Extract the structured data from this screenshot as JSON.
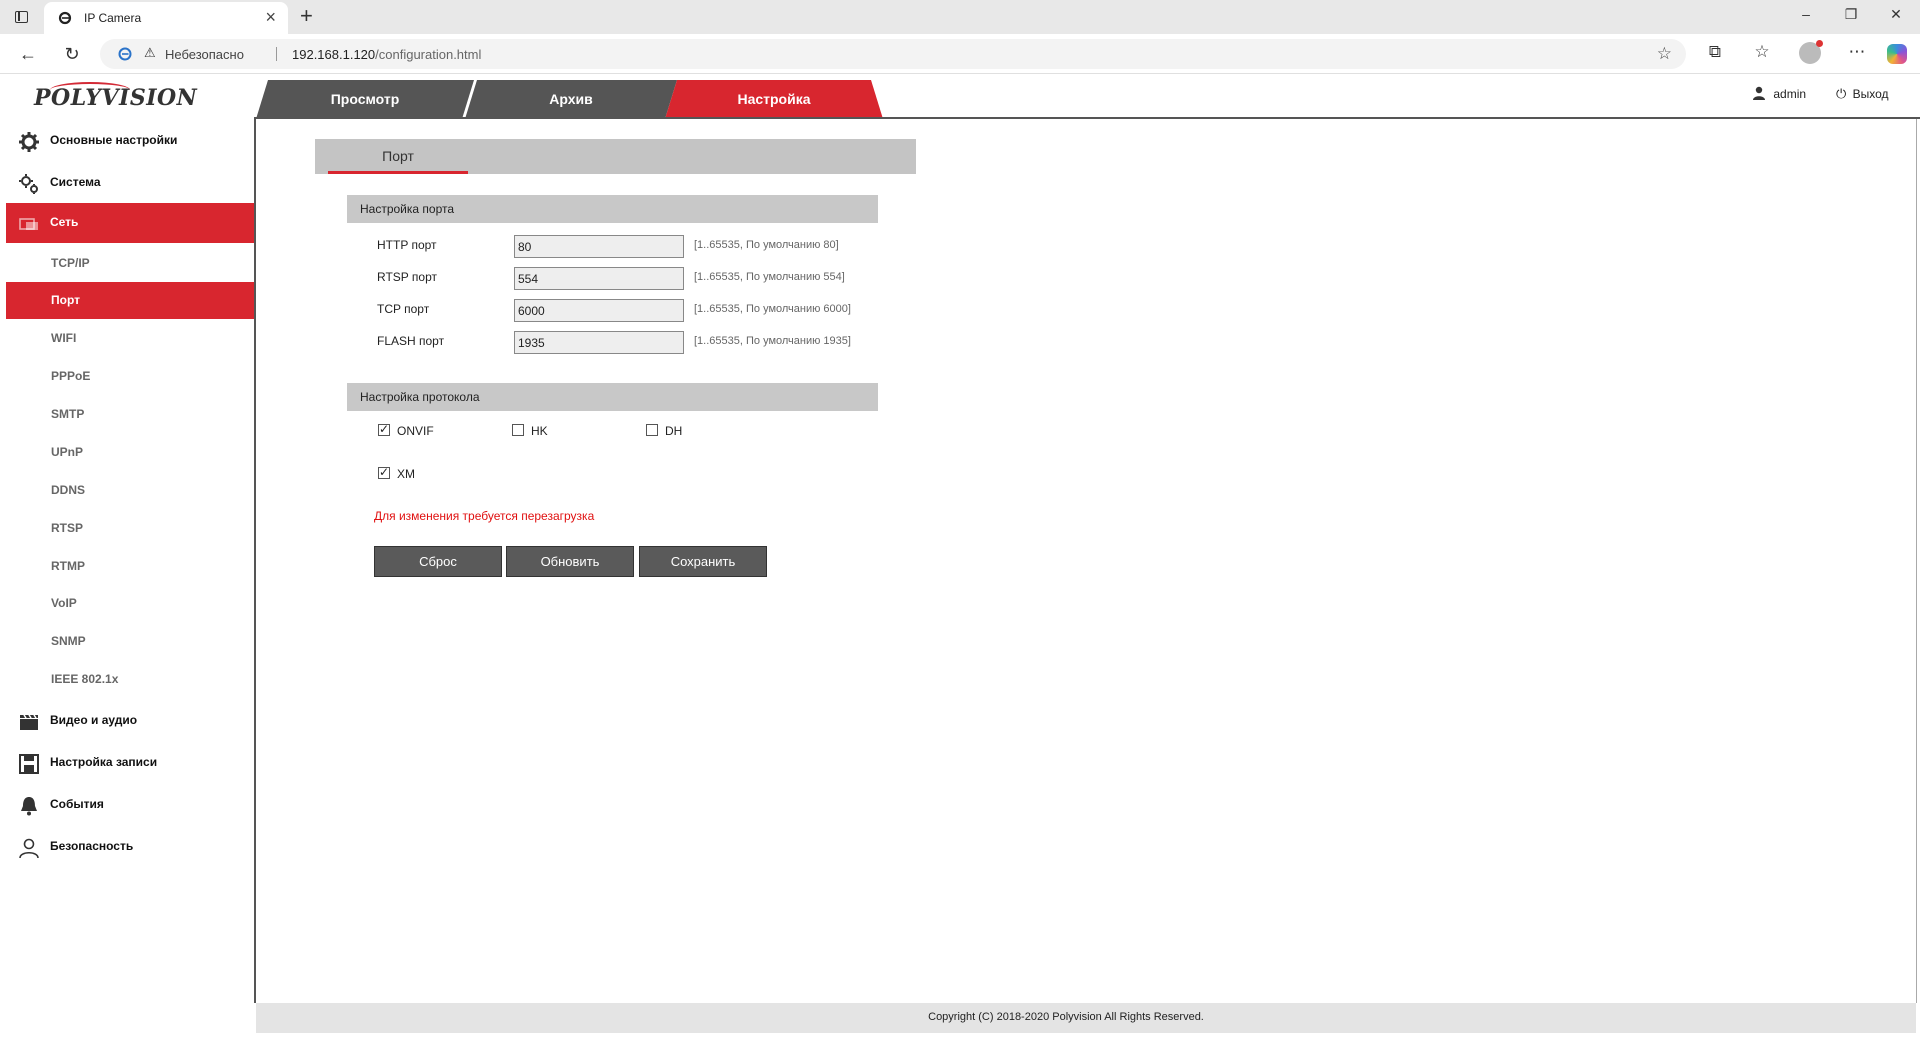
{
  "browser": {
    "tab_title": "IP Camera",
    "insecure_label": "Небезопасно",
    "url_host": "192.168.1.120",
    "url_path": "/configuration.html"
  },
  "header": {
    "logo": "POLYVISION",
    "tabs": [
      {
        "label": "Просмотр"
      },
      {
        "label": "Архив"
      },
      {
        "label": "Настройка"
      }
    ],
    "user_label": "admin",
    "logout_label": "Выход"
  },
  "sidebar": {
    "top_items": [
      {
        "label": "Основные настройки",
        "icon": "gear-icon"
      },
      {
        "label": "Система",
        "icon": "gears-icon"
      },
      {
        "label": "Сеть",
        "icon": "network-icon"
      }
    ],
    "sub_items": [
      {
        "label": "TCP/IP"
      },
      {
        "label": "Порт"
      },
      {
        "label": "WIFI"
      },
      {
        "label": "PPPoE"
      },
      {
        "label": "SMTP"
      },
      {
        "label": "UPnP"
      },
      {
        "label": "DDNS"
      },
      {
        "label": "RTSP"
      },
      {
        "label": "RTMP"
      },
      {
        "label": "VoIP"
      },
      {
        "label": "SNMP"
      },
      {
        "label": "IEEE 802.1x"
      }
    ],
    "bottom_items": [
      {
        "label": "Видео и аудио",
        "icon": "clapperboard-icon"
      },
      {
        "label": "Настройка записи",
        "icon": "floppy-icon"
      },
      {
        "label": "События",
        "icon": "bell-icon"
      },
      {
        "label": "Безопасность",
        "icon": "user-icon"
      }
    ]
  },
  "content": {
    "section_tab": "Порт",
    "port_group_title": "Настройка порта",
    "ports": [
      {
        "label": "HTTP порт",
        "value": "80",
        "hint": "[1..65535, По умолчанию 80]"
      },
      {
        "label": "RTSP порт",
        "value": "554",
        "hint": "[1..65535, По умолчанию 554]"
      },
      {
        "label": "TCP порт",
        "value": "6000",
        "hint": "[1..65535, По умолчанию 6000]"
      },
      {
        "label": "FLASH порт",
        "value": "1935",
        "hint": "[1..65535, По умолчанию 1935]"
      }
    ],
    "protocol_group_title": "Настройка протокола",
    "protocols": [
      {
        "label": "ONVIF",
        "checked": true
      },
      {
        "label": "HK",
        "checked": false
      },
      {
        "label": "DH",
        "checked": false
      },
      {
        "label": "XM",
        "checked": true
      }
    ],
    "reboot_warning": "Для изменения требуется перезагрузка",
    "buttons": {
      "reset": "Сброс",
      "refresh": "Обновить",
      "save": "Сохранить"
    }
  },
  "footer": {
    "copyright": "Copyright (C) 2018-2020 Polyvision All Rights Reserved."
  },
  "colors": {
    "accent": "#d8262f",
    "dark_tab": "#555555",
    "warning_text": "#e01010"
  }
}
